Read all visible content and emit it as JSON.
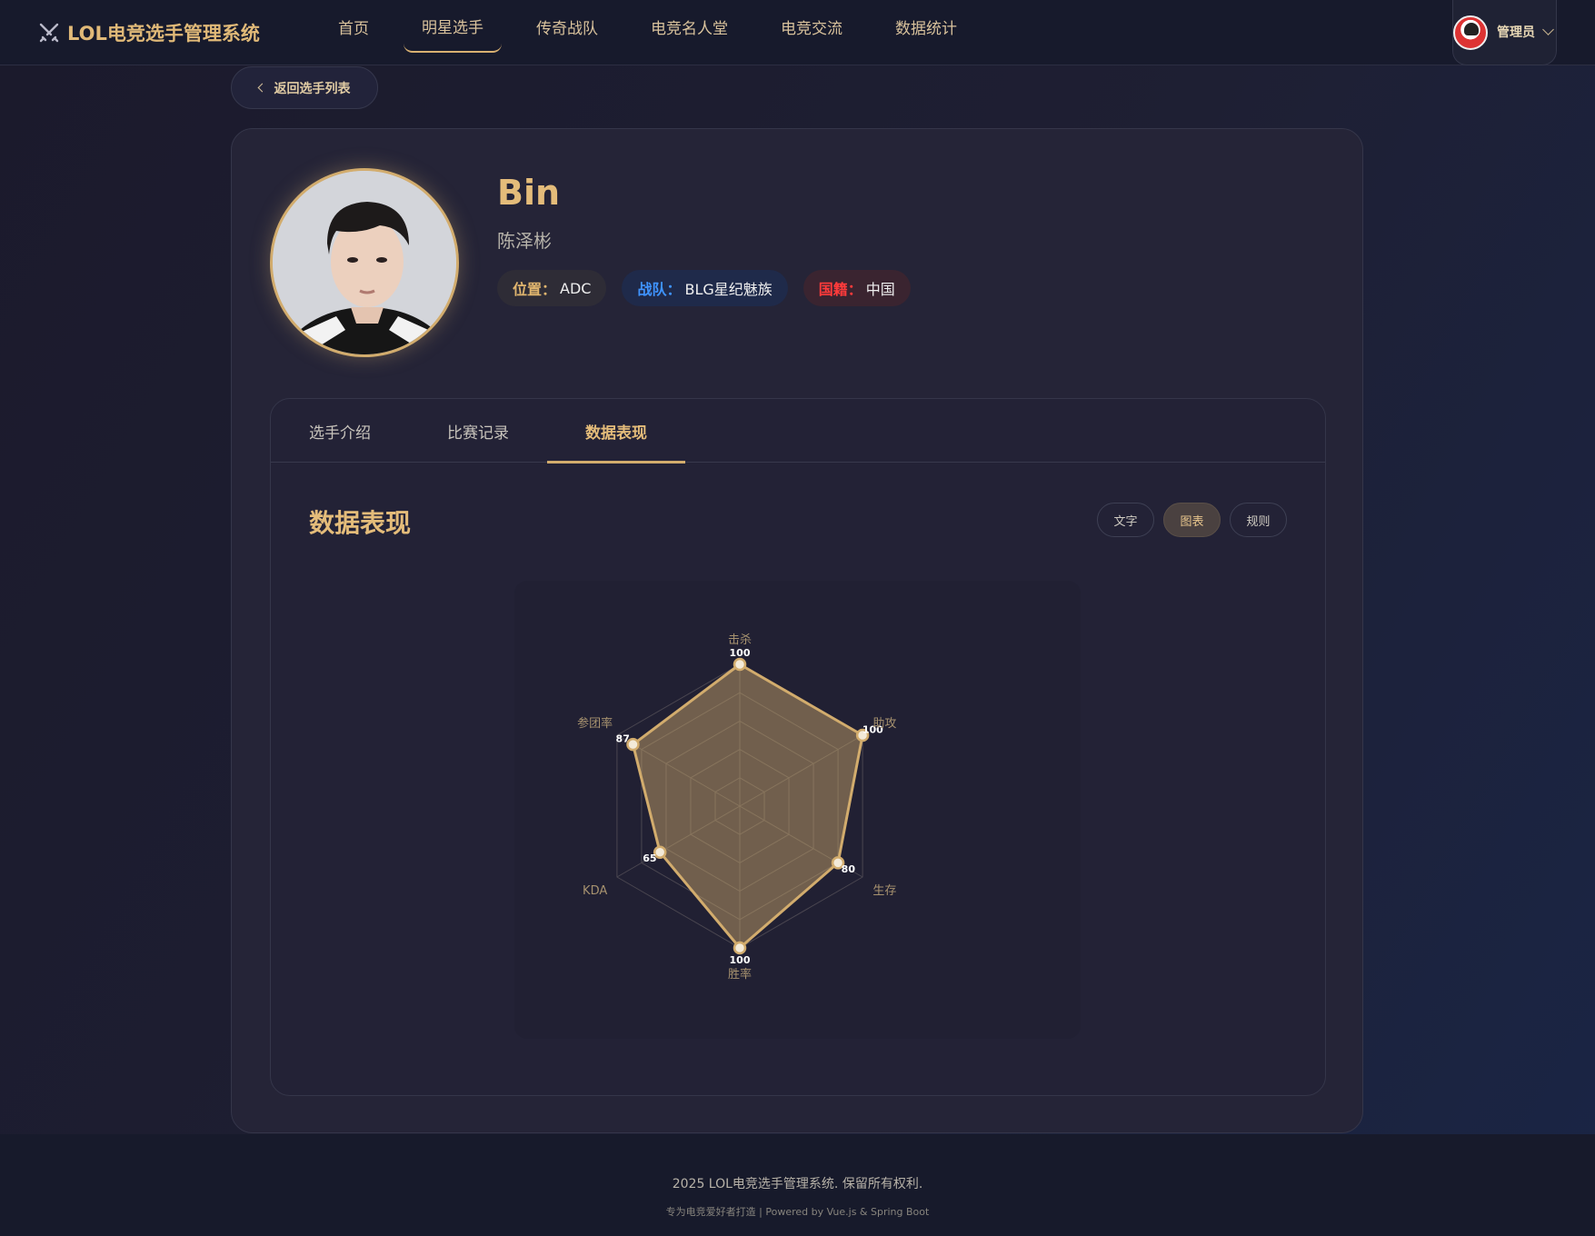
{
  "app": {
    "logo_text": "LOL电竞选手管理系统",
    "nav": [
      "首页",
      "明星选手",
      "传奇战队",
      "电竞名人堂",
      "电竞交流",
      "数据统计"
    ],
    "user_name": "管理员"
  },
  "back_label": "返回选手列表",
  "player": {
    "name": "Bin",
    "real_name": "陈泽彬",
    "tags": [
      {
        "key": "位置：",
        "value": "ADC"
      },
      {
        "key": "战队：",
        "value": "BLG星纪魅族"
      },
      {
        "key": "国籍：",
        "value": "中国"
      }
    ]
  },
  "tabs": [
    "选手介绍",
    "比赛记录",
    "数据表现"
  ],
  "section_title": "数据表现",
  "modes": [
    "文字",
    "图表",
    "规则"
  ],
  "colors": {
    "accent": "#d2ac6d",
    "team": "#3f94ff",
    "nationality": "#ff3b3b"
  },
  "chart_data": {
    "type": "radar",
    "axes": [
      "击杀",
      "助攻",
      "生存",
      "胜率",
      "KDA",
      "参团率"
    ],
    "values": [
      100,
      100,
      80,
      100,
      65,
      87
    ],
    "max": 100
  },
  "footer": {
    "line1": "2025 LOL电竞选手管理系统. 保留所有权利.",
    "line2": "专为电竞爱好者打造 | Powered by Vue.js & Spring Boot"
  }
}
